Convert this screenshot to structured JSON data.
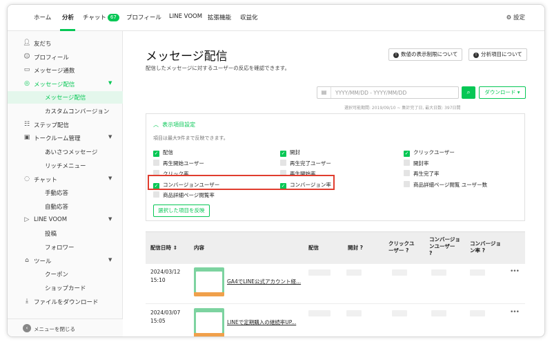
{
  "topnav": {
    "tabs": [
      {
        "label": "ホーム"
      },
      {
        "label": "分析"
      },
      {
        "label": "チャット",
        "badge": "67"
      },
      {
        "label": "プロフィール"
      },
      {
        "label": "LINE VOOM"
      },
      {
        "label": "拡張機能"
      },
      {
        "label": "収益化"
      }
    ],
    "active_tab": "分析",
    "settings_label": "設定"
  },
  "sidebar": {
    "items": [
      {
        "label": "友だち",
        "icon": "person-add-icon"
      },
      {
        "label": "プロフィール",
        "icon": "profile-icon"
      },
      {
        "label": "メッセージ通数",
        "icon": "inbox-icon"
      },
      {
        "label": "メッセージ配信",
        "icon": "broadcast-icon"
      },
      {
        "label": "メッセージ配信"
      },
      {
        "label": "カスタムコンバージョン"
      },
      {
        "label": "ステップ配信",
        "icon": "step-icon"
      },
      {
        "label": "トークルーム管理",
        "icon": "room-icon"
      },
      {
        "label": "あいさつメッセージ"
      },
      {
        "label": "リッチメニュー"
      },
      {
        "label": "チャット",
        "icon": "chat-icon"
      },
      {
        "label": "手動応答"
      },
      {
        "label": "自動応答"
      },
      {
        "label": "LINE VOOM",
        "icon": "play-icon"
      },
      {
        "label": "投稿"
      },
      {
        "label": "フォロワー"
      },
      {
        "label": "ツール",
        "icon": "shop-icon"
      },
      {
        "label": "クーポン"
      },
      {
        "label": "ショップカード"
      },
      {
        "label": "ファイルをダウンロード",
        "icon": "download-icon"
      }
    ],
    "close_label": "メニューを閉じる"
  },
  "main": {
    "title": "メッセージ配信",
    "subtitle": "配信したメッセージに対するユーザーの反応を確認できます。",
    "header_buttons": [
      {
        "label": "数値の表示制限について"
      },
      {
        "label": "分析項目について"
      }
    ],
    "date_placeholder": "YYYY/MM/DD - YYYY/MM/DD",
    "download_label": "ダウンロード ▾",
    "range_note": "選択可能期間: 2019/09/10 ~ 集計完了日, 最大日数: 397日間",
    "display_settings": {
      "title": "表示項目設定",
      "note": "項目は最大9件まで反映できます。",
      "checkboxes": [
        {
          "label": "配信",
          "checked": true
        },
        {
          "label": "開封",
          "checked": true
        },
        {
          "label": "クリックユーザー",
          "checked": true
        },
        {
          "label": "再生開始ユーザー",
          "checked": false
        },
        {
          "label": "再生完了ユーザー",
          "checked": false
        },
        {
          "label": "開封率",
          "checked": false
        },
        {
          "label": "クリック率",
          "checked": false
        },
        {
          "label": "再生開始率",
          "checked": false
        },
        {
          "label": "再生完了率",
          "checked": false
        },
        {
          "label": "コンバージョンユーザー",
          "checked": true
        },
        {
          "label": "コンバージョン率",
          "checked": true
        },
        {
          "label": "商品詳細ページ閲覧 ユーザー数",
          "checked": false
        },
        {
          "label": "商品詳細ページ閲覧率",
          "checked": false
        }
      ],
      "apply_label": "選択した項目を反映"
    },
    "table": {
      "headers": {
        "date": "配信日時 ⇕",
        "content": "内容",
        "delivery": "配信",
        "open": "開封 ?",
        "click_user_1": "クリックユ",
        "click_user_2": "ーザー ?",
        "conv_user_1": "コンバージョ",
        "conv_user_2": "ンユーザー",
        "conv_user_3": "?",
        "conv_rate_1": "コンバージョ",
        "conv_rate_2": "ン率 ?"
      },
      "rows": [
        {
          "date": "2024/03/12",
          "time": "15:10",
          "title": "GA4でLINE公式アカウント経..."
        },
        {
          "date": "2024/03/07",
          "time": "15:05",
          "title": "LINEで定期購入の継続率UP..."
        }
      ]
    }
  },
  "colors": {
    "accent": "#06c755",
    "highlight": "#e03c2e"
  }
}
